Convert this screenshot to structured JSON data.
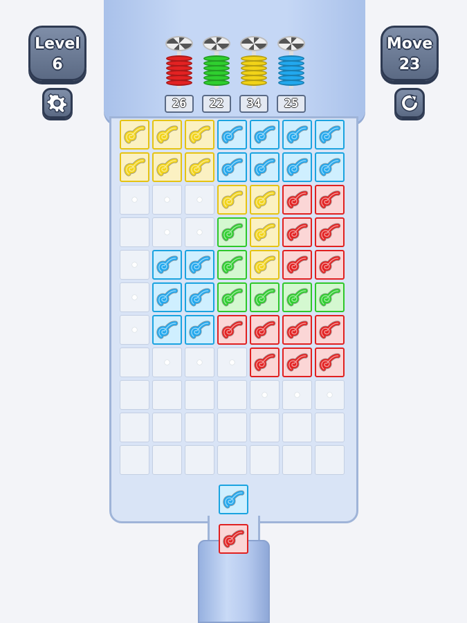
{
  "hud": {
    "level_label": "Level",
    "level_value": "6",
    "move_label": "Move",
    "move_value": "23"
  },
  "icons": {
    "settings": "gear-icon",
    "restart": "restart-icon"
  },
  "pegs": [
    {
      "color": "#e32222",
      "count": "26"
    },
    {
      "color": "#2fcf2f",
      "count": "22"
    },
    {
      "color": "#f2d318",
      "count": "34"
    },
    {
      "color": "#22a8ee",
      "count": "25"
    }
  ],
  "colors": {
    "yellow": "#f2d318",
    "blue": "#22a8ee",
    "green": "#2fcf2f",
    "red": "#e32222"
  },
  "board": [
    [
      "yellow",
      "yellow",
      "yellow",
      "blue",
      "blue",
      "blue",
      "blue"
    ],
    [
      "yellow",
      "yellow",
      "yellow",
      "blue",
      "blue",
      "blue",
      "blue"
    ],
    [
      "dot",
      "dot",
      "dot",
      "yellow",
      "yellow",
      "red",
      "red"
    ],
    [
      "empty",
      "dot",
      "dot",
      "green",
      "yellow",
      "red",
      "red"
    ],
    [
      "dot",
      "blue",
      "blue",
      "green",
      "yellow",
      "red",
      "red"
    ],
    [
      "dot",
      "blue",
      "blue",
      "green",
      "green",
      "green",
      "green"
    ],
    [
      "dot",
      "blue",
      "blue",
      "red",
      "red",
      "red",
      "red"
    ],
    [
      "empty",
      "dot",
      "dot",
      "dot",
      "red",
      "red",
      "red"
    ],
    [
      "empty",
      "empty",
      "empty",
      "empty",
      "dot",
      "dot",
      "dot"
    ],
    [
      "empty",
      "empty",
      "empty",
      "empty",
      "empty",
      "empty",
      "empty"
    ],
    [
      "empty",
      "empty",
      "empty",
      "empty",
      "empty",
      "empty",
      "empty"
    ]
  ],
  "queue": [
    "blue",
    "red"
  ]
}
